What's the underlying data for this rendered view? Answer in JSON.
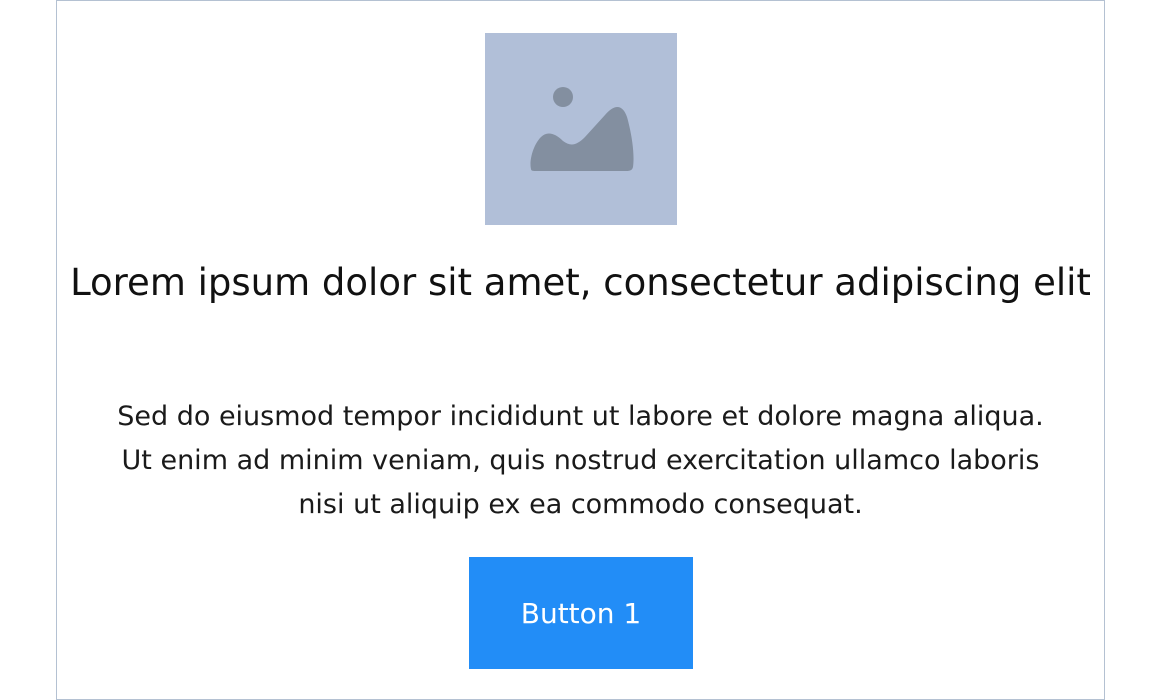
{
  "image": {
    "icon": "image-placeholder-icon",
    "background_color": "#b1bfd8",
    "icon_color": "#838fa0"
  },
  "title": "Lorem ipsum dolor sit amet, consectetur adipiscing elit",
  "body": "Sed do eiusmod tempor incididunt ut labore et dolore magna aliqua. Ut enim ad minim veniam, quis nostrud exercitation ullamco laboris nisi ut aliquip ex ea commodo consequat.",
  "button": {
    "label": "Button 1",
    "color": "#228df7"
  }
}
